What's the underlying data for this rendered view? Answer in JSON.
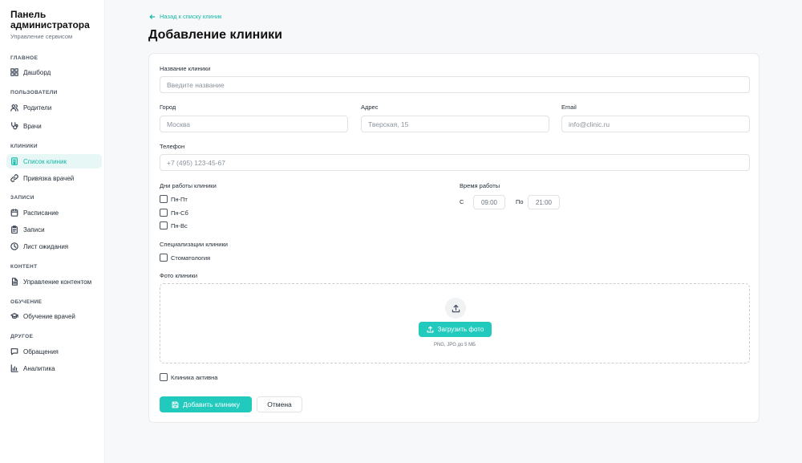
{
  "sidebar": {
    "title": "Панель администратора",
    "subtitle": "Управление сервисом",
    "sections": [
      {
        "label": "ГЛАВНОЕ",
        "items": [
          {
            "label": "Дашборд",
            "icon": "dashboard-icon"
          }
        ]
      },
      {
        "label": "ПОЛЬЗОВАТЕЛИ",
        "items": [
          {
            "label": "Родители",
            "icon": "users-icon"
          },
          {
            "label": "Врачи",
            "icon": "stethoscope-icon"
          }
        ]
      },
      {
        "label": "КЛИНИКИ",
        "items": [
          {
            "label": "Список клиник",
            "icon": "building-icon",
            "active": true
          },
          {
            "label": "Привязка врачей",
            "icon": "link-icon"
          }
        ]
      },
      {
        "label": "ЗАПИСИ",
        "items": [
          {
            "label": "Расписание",
            "icon": "calendar-icon"
          },
          {
            "label": "Записи",
            "icon": "clipboard-icon"
          },
          {
            "label": "Лист ожидания",
            "icon": "clock-icon"
          }
        ]
      },
      {
        "label": "КОНТЕНТ",
        "items": [
          {
            "label": "Управление контентом",
            "icon": "document-icon"
          }
        ]
      },
      {
        "label": "ОБУЧЕНИЕ",
        "items": [
          {
            "label": "Обучение врачей",
            "icon": "graduation-cap-icon"
          }
        ]
      },
      {
        "label": "ДРУГОЕ",
        "items": [
          {
            "label": "Обращения",
            "icon": "message-icon"
          },
          {
            "label": "Аналитика",
            "icon": "chart-icon"
          }
        ]
      }
    ]
  },
  "header": {
    "back_label": "Назад к списку клиник",
    "title": "Добавление клиники"
  },
  "form": {
    "name": {
      "label": "Название клиники",
      "placeholder": "Введите название",
      "value": ""
    },
    "city": {
      "label": "Город",
      "placeholder": "Москва",
      "value": ""
    },
    "address": {
      "label": "Адрес",
      "placeholder": "Тверская, 15",
      "value": ""
    },
    "email": {
      "label": "Email",
      "placeholder": "info@clinic.ru",
      "value": ""
    },
    "phone": {
      "label": "Телефон",
      "placeholder": "+7 (495) 123-45-67",
      "value": ""
    },
    "workdays": {
      "label": "Дни работы клиники",
      "options": [
        {
          "label": "Пн-Пт",
          "checked": false
        },
        {
          "label": "Пн-Сб",
          "checked": false
        },
        {
          "label": "Пн-Вс",
          "checked": false
        }
      ]
    },
    "hours": {
      "label": "Время работы",
      "from_label": "С",
      "from_value": "09:00",
      "to_label": "По",
      "to_value": "21:00"
    },
    "specializations": {
      "label": "Специализации клиники",
      "options": [
        {
          "label": "Стоматология",
          "checked": false
        }
      ]
    },
    "photo": {
      "label": "Фото клиники",
      "upload_label": "Загрузить фото",
      "hint": "PNG, JPG до 5 МБ"
    },
    "active": {
      "label": "Клиника активна",
      "checked": false
    },
    "submit_label": "Добавить клинику",
    "cancel_label": "Отмена"
  },
  "colors": {
    "accent": "#22c9bd",
    "accent_text": "#14b8a6",
    "active_bg": "#e6f7f6"
  }
}
